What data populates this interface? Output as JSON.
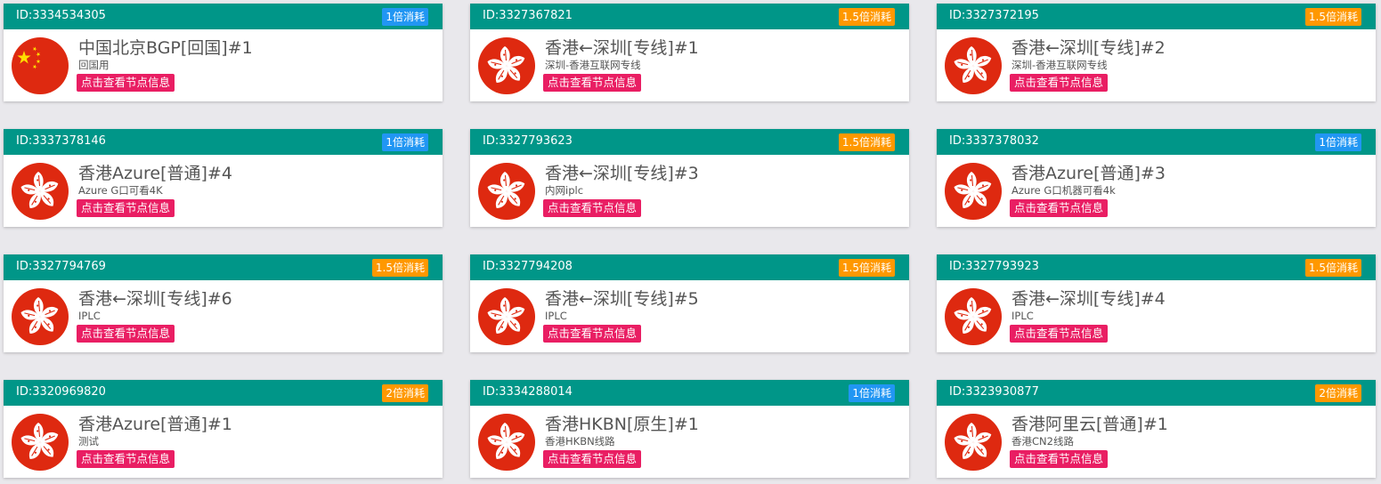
{
  "colors": {
    "header": "#009688",
    "badge_blue": "#2196f3",
    "badge_orange": "#ff9800",
    "info_button": "#e91e63",
    "flag_red": "#de2910",
    "flag_star": "#ffde00"
  },
  "cards": [
    {
      "id": "ID:3334534305",
      "rate": "1倍消耗",
      "rate_color": "blue",
      "flag": "china-flag-icon",
      "title": "中国北京BGP[回国]#1",
      "desc": "回国用",
      "button": "点击查看节点信息"
    },
    {
      "id": "ID:3327367821",
      "rate": "1.5倍消耗",
      "rate_color": "orange",
      "flag": "hongkong-flag-icon",
      "title": "香港←深圳[专线]#1",
      "desc": "深圳-香港互联网专线",
      "button": "点击查看节点信息"
    },
    {
      "id": "ID:3327372195",
      "rate": "1.5倍消耗",
      "rate_color": "orange",
      "flag": "hongkong-flag-icon",
      "title": "香港←深圳[专线]#2",
      "desc": "深圳-香港互联网专线",
      "button": "点击查看节点信息"
    },
    {
      "id": "ID:3337378146",
      "rate": "1倍消耗",
      "rate_color": "blue",
      "flag": "hongkong-flag-icon",
      "title": "香港Azure[普通]#4",
      "desc": "Azure G口可看4K",
      "button": "点击查看节点信息"
    },
    {
      "id": "ID:3327793623",
      "rate": "1.5倍消耗",
      "rate_color": "orange",
      "flag": "hongkong-flag-icon",
      "title": "香港←深圳[专线]#3",
      "desc": "内网iplc",
      "button": "点击查看节点信息"
    },
    {
      "id": "ID:3337378032",
      "rate": "1倍消耗",
      "rate_color": "blue",
      "flag": "hongkong-flag-icon",
      "title": "香港Azure[普通]#3",
      "desc": "Azure G口机器可看4k",
      "button": "点击查看节点信息"
    },
    {
      "id": "ID:3327794769",
      "rate": "1.5倍消耗",
      "rate_color": "orange",
      "flag": "hongkong-flag-icon",
      "title": "香港←深圳[专线]#6",
      "desc": "IPLC",
      "button": "点击查看节点信息"
    },
    {
      "id": "ID:3327794208",
      "rate": "1.5倍消耗",
      "rate_color": "orange",
      "flag": "hongkong-flag-icon",
      "title": "香港←深圳[专线]#5",
      "desc": "IPLC",
      "button": "点击查看节点信息"
    },
    {
      "id": "ID:3327793923",
      "rate": "1.5倍消耗",
      "rate_color": "orange",
      "flag": "hongkong-flag-icon",
      "title": "香港←深圳[专线]#4",
      "desc": "IPLC",
      "button": "点击查看节点信息"
    },
    {
      "id": "ID:3320969820",
      "rate": "2倍消耗",
      "rate_color": "orange",
      "flag": "hongkong-flag-icon",
      "title": "香港Azure[普通]#1",
      "desc": "测试",
      "button": "点击查看节点信息"
    },
    {
      "id": "ID:3334288014",
      "rate": "1倍消耗",
      "rate_color": "blue",
      "flag": "hongkong-flag-icon",
      "title": "香港HKBN[原生]#1",
      "desc": "香港HKBN线路",
      "button": "点击查看节点信息"
    },
    {
      "id": "ID:3323930877",
      "rate": "2倍消耗",
      "rate_color": "orange",
      "flag": "hongkong-flag-icon",
      "title": "香港阿里云[普通]#1",
      "desc": "香港CN2线路",
      "button": "点击查看节点信息"
    }
  ]
}
